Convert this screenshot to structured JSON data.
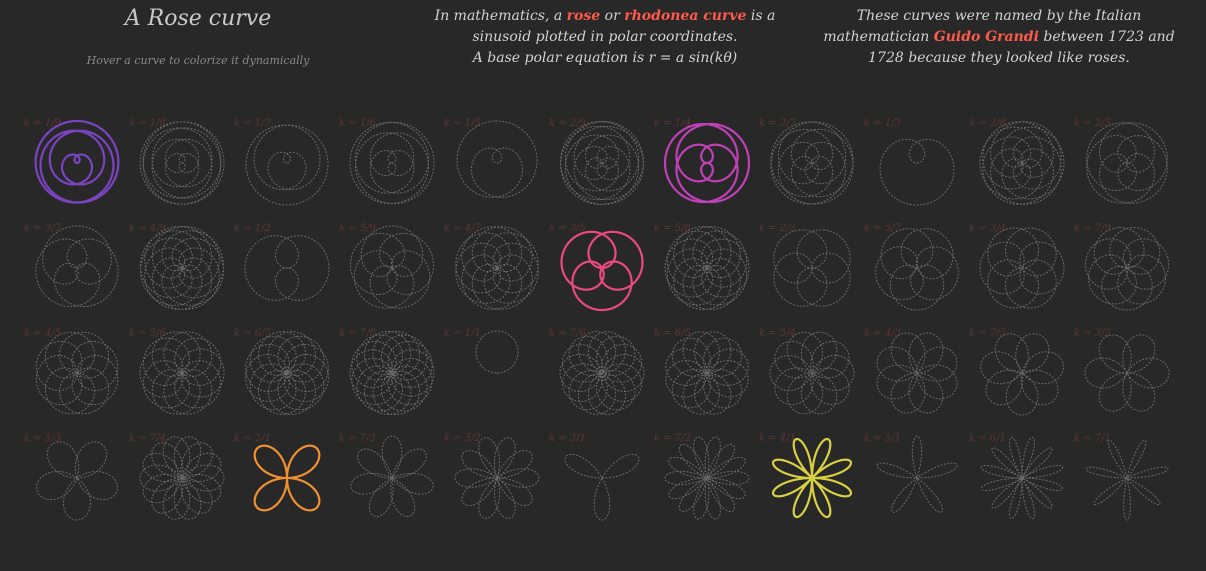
{
  "header": {
    "title": "A Rose curve",
    "subtitle": "Hover a curve to colorize it dynamically",
    "intro": {
      "t1": "In mathematics, a ",
      "rose": "rose",
      "t2": " or ",
      "rhodonea": "rhodonea curve",
      "t3": " is a sinusoid plotted in polar coordinates.",
      "equation": "A base polar equation is r = a sin(kθ)"
    },
    "history": {
      "t1": "These curves were named by the Italian mathematician ",
      "name": "Guido Grandi",
      "t2": " between 1723 and 1728 because they looked like roses."
    }
  },
  "colors": {
    "background": "#282828",
    "label": "#5e3434",
    "inactive_curve": "#6a6a6a",
    "highlight_text": "#ff5a4a"
  },
  "curves": [
    {
      "label": "k = 1/9",
      "n": 1,
      "d": 9,
      "color": "#7a44c0"
    },
    {
      "label": "k = 1/8",
      "n": 1,
      "d": 8
    },
    {
      "label": "k = 1/7",
      "n": 1,
      "d": 7
    },
    {
      "label": "k = 1/6",
      "n": 1,
      "d": 6
    },
    {
      "label": "k = 1/5",
      "n": 1,
      "d": 5
    },
    {
      "label": "k = 2/9",
      "n": 2,
      "d": 9
    },
    {
      "label": "k = 1/4",
      "n": 1,
      "d": 4,
      "color": "#c040b8"
    },
    {
      "label": "k = 2/7",
      "n": 2,
      "d": 7
    },
    {
      "label": "k = 1/3",
      "n": 1,
      "d": 3
    },
    {
      "label": "k = 3/8",
      "n": 3,
      "d": 8
    },
    {
      "label": "k = 2/5",
      "n": 2,
      "d": 5
    },
    {
      "label": "k = 3/7",
      "n": 3,
      "d": 7
    },
    {
      "label": "k = 4/9",
      "n": 4,
      "d": 9
    },
    {
      "label": "k = 1/2",
      "n": 1,
      "d": 2
    },
    {
      "label": "k = 5/9",
      "n": 5,
      "d": 9
    },
    {
      "label": "k = 4/7",
      "n": 4,
      "d": 7
    },
    {
      "label": "k = 3/5",
      "n": 3,
      "d": 5,
      "color": "#e84a80"
    },
    {
      "label": "k = 5/8",
      "n": 5,
      "d": 8
    },
    {
      "label": "k = 2/3",
      "n": 2,
      "d": 3
    },
    {
      "label": "k = 5/7",
      "n": 5,
      "d": 7
    },
    {
      "label": "k = 3/4",
      "n": 3,
      "d": 4
    },
    {
      "label": "k = 7/9",
      "n": 7,
      "d": 9
    },
    {
      "label": "k = 4/5",
      "n": 4,
      "d": 5
    },
    {
      "label": "k = 5/6",
      "n": 5,
      "d": 6
    },
    {
      "label": "k = 6/7",
      "n": 6,
      "d": 7
    },
    {
      "label": "k = 7/8",
      "n": 7,
      "d": 8
    },
    {
      "label": "k = 1/1",
      "n": 1,
      "d": 1
    },
    {
      "label": "k = 7/6",
      "n": 7,
      "d": 6
    },
    {
      "label": "k = 6/5",
      "n": 6,
      "d": 5
    },
    {
      "label": "k = 5/4",
      "n": 5,
      "d": 4
    },
    {
      "label": "k = 4/3",
      "n": 4,
      "d": 3
    },
    {
      "label": "k = 7/5",
      "n": 7,
      "d": 5
    },
    {
      "label": "k = 3/2",
      "n": 3,
      "d": 2
    },
    {
      "label": "k = 5/3",
      "n": 5,
      "d": 3
    },
    {
      "label": "k = 7/4",
      "n": 7,
      "d": 4
    },
    {
      "label": "k = 2/1",
      "n": 2,
      "d": 1,
      "color": "#f09030"
    },
    {
      "label": "k = 7/3",
      "n": 7,
      "d": 3
    },
    {
      "label": "k = 5/2",
      "n": 5,
      "d": 2
    },
    {
      "label": "k = 3/1",
      "n": 3,
      "d": 1
    },
    {
      "label": "k = 7/2",
      "n": 7,
      "d": 2
    },
    {
      "label": "k = 4/1",
      "n": 4,
      "d": 1,
      "color": "#d8d040"
    },
    {
      "label": "k = 5/1",
      "n": 5,
      "d": 1
    },
    {
      "label": "k = 6/1",
      "n": 6,
      "d": 1
    },
    {
      "label": "k = 7/1",
      "n": 7,
      "d": 1
    }
  ]
}
